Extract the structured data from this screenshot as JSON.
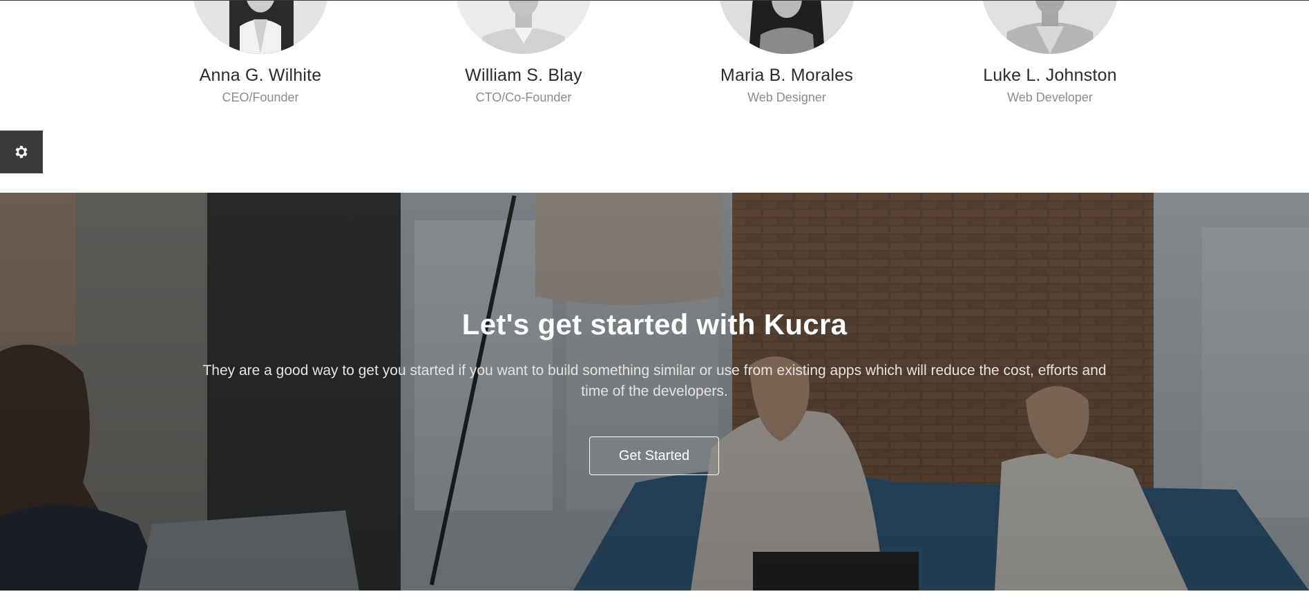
{
  "team": {
    "members": [
      {
        "name": "Anna G. Wilhite",
        "role": "CEO/Founder"
      },
      {
        "name": "William S. Blay",
        "role": "CTO/Co-Founder"
      },
      {
        "name": "Maria B. Morales",
        "role": "Web Designer"
      },
      {
        "name": "Luke L. Johnston",
        "role": "Web Developer"
      }
    ]
  },
  "settings": {
    "icon": "gear-icon"
  },
  "cta": {
    "title": "Let's get started with Kucra",
    "description": "They are a good way to get you started if you want to build something similar or use from existing apps which will reduce the cost, efforts and time of the developers.",
    "button_label": "Get Started"
  },
  "colors": {
    "settings_tab": "#3b3b3b",
    "name_text": "#2b2b2b",
    "role_text": "#8c8c8c",
    "cta_text": "#ffffff"
  }
}
